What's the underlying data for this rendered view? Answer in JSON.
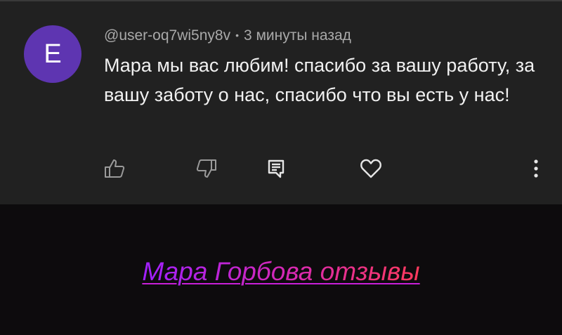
{
  "comment": {
    "avatar_letter": "E",
    "username": "@user-oq7wi5ny8v",
    "separator": "•",
    "time": "3 минуты назад",
    "text": "Мара мы вас любим! спасибо за вашу работу, за вашу заботу о нас, спасибо что вы есть у нас!",
    "colors": {
      "avatar_bg": "#5e35b1",
      "card_bg": "#212121",
      "text": "#f1f1f1",
      "meta": "#a9a9a9"
    },
    "actions": [
      {
        "icon": "thumbs-up-icon"
      },
      {
        "icon": "thumbs-down-icon"
      },
      {
        "icon": "reply-icon"
      },
      {
        "icon": "heart-icon"
      },
      {
        "icon": "more-vertical-icon"
      }
    ]
  },
  "promo": {
    "link_text": "Мара Горбова отзывы",
    "gradient": [
      "#a020ff",
      "#d829b0",
      "#ff3a5c"
    ]
  }
}
